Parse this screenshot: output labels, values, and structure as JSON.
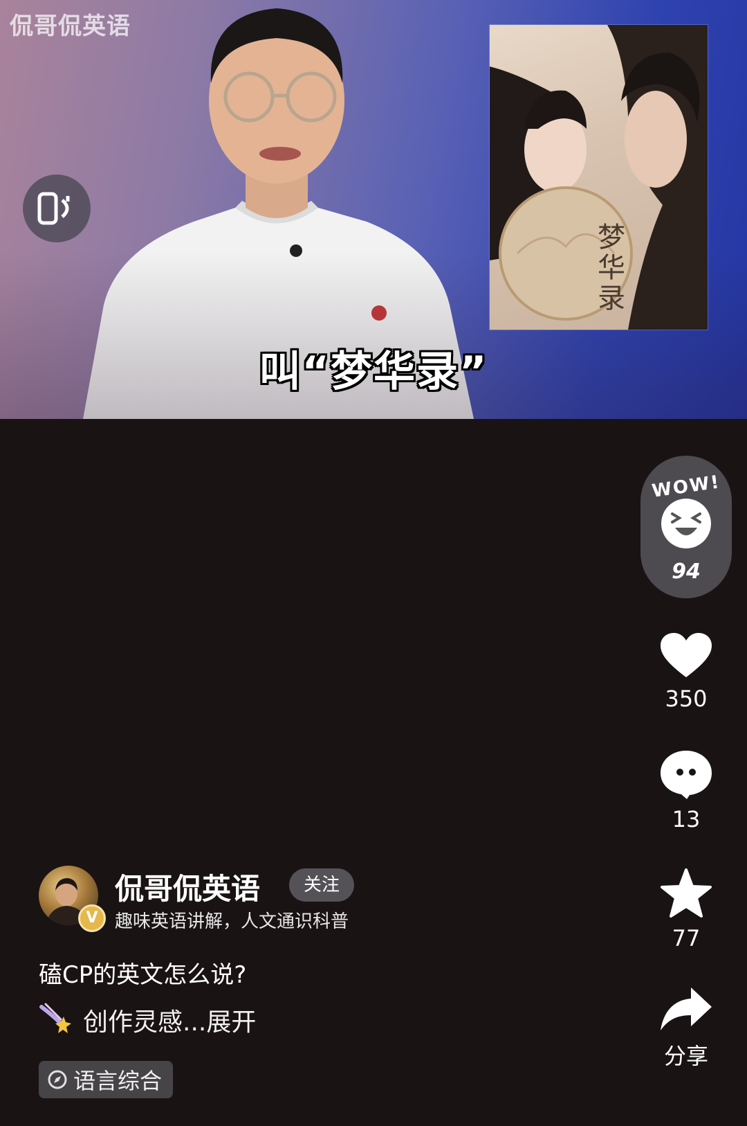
{
  "video": {
    "watermark": "侃哥侃英语",
    "subtitle": "叫“梦华录”",
    "poster_title": "梦华录"
  },
  "actions": {
    "wow_label": "WOW!",
    "wow_count": "94",
    "like_count": "350",
    "comment_count": "13",
    "favorite_count": "77",
    "share_label": "分享"
  },
  "author": {
    "name": "侃哥侃英语",
    "follow_label": "关注",
    "bio": "趣味英语讲解，人文通识科普",
    "verified_badge": "V"
  },
  "post": {
    "caption": "磕CP的英文怎么说?",
    "inspiration_label": "创作灵感...展开",
    "category_tag": "语言综合"
  },
  "icons": {
    "rotate": "phone-rotate-icon",
    "wow": "wow-face-icon",
    "like": "heart-icon",
    "comment": "comment-bubble-icon",
    "favorite": "star-icon",
    "share": "share-arrow-icon",
    "inspiration": "comet-icon",
    "tag": "compass-icon"
  }
}
